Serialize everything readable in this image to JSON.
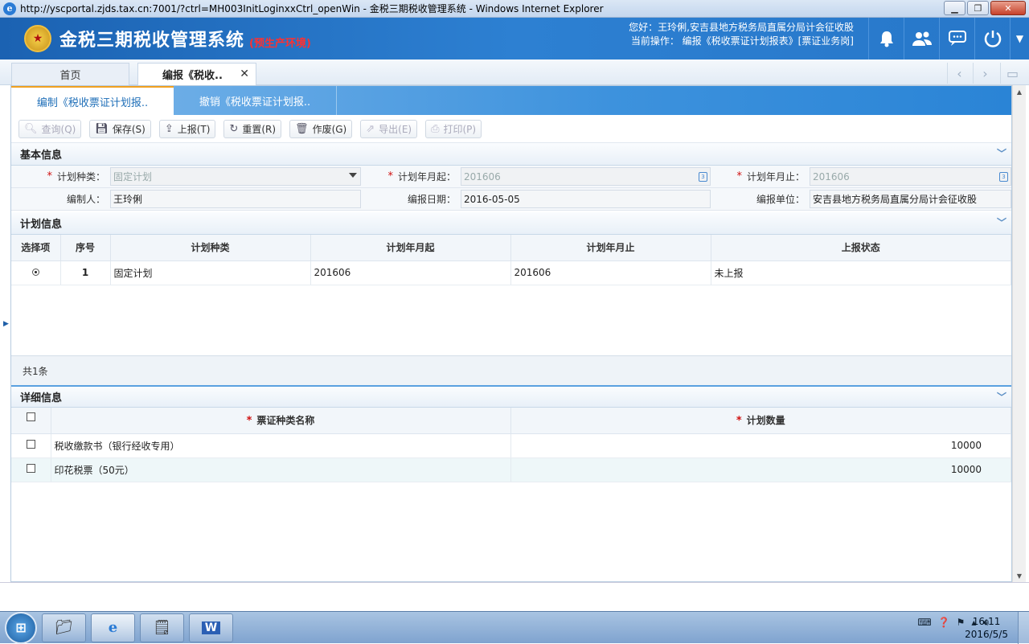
{
  "window": {
    "title": "http://yscportal.zjds.tax.cn:7001/?ctrl=MH003InitLoginxxCtrl_openWin - 金税三期税收管理系统 - Windows Internet Explorer"
  },
  "header": {
    "app_name": "金税三期税收管理系统",
    "env_label": "(预生产环境)",
    "greeting": "您好：王玲俐,安吉县地方税务局直属分局计会征收股",
    "current_op": "当前操作： 编报《税收票证计划报表》[票证业务岗]"
  },
  "tabs": [
    {
      "label": "首页"
    },
    {
      "label": "编报《税收.."
    }
  ],
  "subtabs": [
    {
      "label": "编制《税收票证计划报.."
    },
    {
      "label": "撤销《税收票证计划报.."
    }
  ],
  "toolbar": {
    "query": "查询(Q)",
    "save": "保存(S)",
    "report": "上报(T)",
    "reset": "重置(R)",
    "void": "作废(G)",
    "export": "导出(E)",
    "print": "打印(P)"
  },
  "basic_info": {
    "title": "基本信息",
    "plan_type_label": "计划种类：",
    "plan_type_value": "固定计划",
    "start_label": "计划年月起：",
    "start_value": "201606",
    "end_label": "计划年月止：",
    "end_value": "201606",
    "preparer_label": "编制人：",
    "preparer_value": "王玲俐",
    "date_label": "编报日期：",
    "date_value": "2016-05-05",
    "unit_label": "编报单位：",
    "unit_value": "安吉县地方税务局直属分局计会征收股"
  },
  "plan_info": {
    "title": "计划信息",
    "columns": [
      "选择项",
      "序号",
      "计划种类",
      "计划年月起",
      "计划年月止",
      "上报状态"
    ],
    "rows": [
      {
        "seq": "1",
        "type": "固定计划",
        "start": "201606",
        "end": "201606",
        "status": "未上报"
      }
    ],
    "total": "共1条"
  },
  "detail_info": {
    "title": "详细信息",
    "col_name": "票证种类名称",
    "col_qty": "计划数量",
    "rows": [
      {
        "name": "税收缴款书（银行经收专用）",
        "qty": "10000"
      },
      {
        "name": "印花税票（50元）",
        "qty": "10000"
      }
    ]
  },
  "taskbar": {
    "time": "16:11",
    "date": "2016/5/5"
  },
  "colors": {
    "header_blue": "#2d80d2",
    "subtab_blue": "#3d92dd",
    "required_red": "#d01010",
    "env_red": "#ff3030"
  }
}
